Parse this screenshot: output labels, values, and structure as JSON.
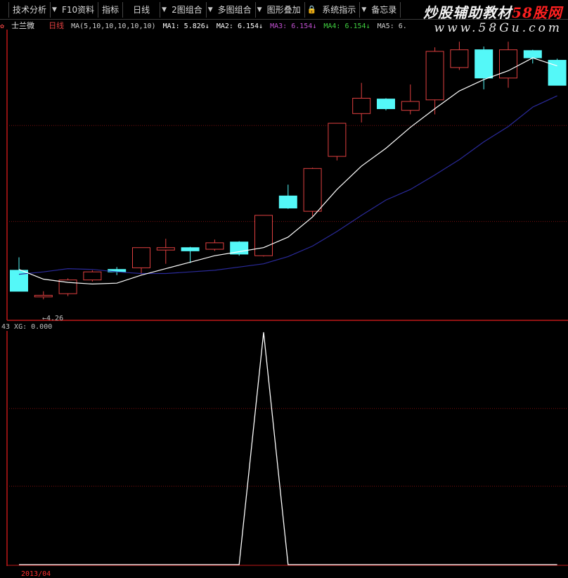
{
  "toolbar": {
    "items": [
      "技术分析",
      "F10资料",
      "指标",
      "日线",
      "2图组合",
      "多图组合",
      "图形叠加",
      "系统指示",
      "备忘录"
    ],
    "arrow": "▼",
    "lock": "🔒"
  },
  "watermark": {
    "line1a": "炒股辅助教材",
    "line1b": "58股网",
    "line2": "www.58Gu.com"
  },
  "stock": {
    "name": "士兰微",
    "period": "日线"
  },
  "ma_header": {
    "spec": "MA(5,10,10,10,10,10)",
    "ma1": "MA1: 5.826↓",
    "ma2": "MA2: 6.154↓",
    "ma3": "MA3: 6.154↓",
    "ma4": "MA4: 6.154↓",
    "ma5": "MA5: 6."
  },
  "low_label": "←4.26",
  "indicator": {
    "label": "43 XG: 0.000"
  },
  "date_label": "2013/04",
  "colors": {
    "up": "#e04040",
    "down": "#54f8f8",
    "ma1": "#ffffff",
    "ma2": "#2a2a9a",
    "grid": "#7a1010",
    "frame": "#c01818",
    "ma3": "#b040c0",
    "ma4": "#40d040"
  },
  "chart_data": {
    "type": "candlestick",
    "price_range": [
      4.0,
      7.6
    ],
    "candles": [
      {
        "o": 4.62,
        "h": 4.78,
        "l": 4.38,
        "c": 4.36
      },
      {
        "o": 4.29,
        "h": 4.36,
        "l": 4.26,
        "c": 4.31
      },
      {
        "o": 4.33,
        "h": 4.52,
        "l": 4.3,
        "c": 4.5
      },
      {
        "o": 4.5,
        "h": 4.62,
        "l": 4.48,
        "c": 4.6
      },
      {
        "o": 4.63,
        "h": 4.66,
        "l": 4.56,
        "c": 4.6
      },
      {
        "o": 4.65,
        "h": 4.88,
        "l": 4.57,
        "c": 4.9
      },
      {
        "o": 4.87,
        "h": 5.01,
        "l": 4.7,
        "c": 4.9
      },
      {
        "o": 4.9,
        "h": 4.91,
        "l": 4.71,
        "c": 4.86
      },
      {
        "o": 4.88,
        "h": 5.0,
        "l": 4.86,
        "c": 4.96
      },
      {
        "o": 4.97,
        "h": 4.98,
        "l": 4.8,
        "c": 4.82
      },
      {
        "o": 4.8,
        "h": 5.3,
        "l": 4.79,
        "c": 5.3
      },
      {
        "o": 5.54,
        "h": 5.68,
        "l": 5.38,
        "c": 5.39
      },
      {
        "o": 5.35,
        "h": 5.89,
        "l": 5.29,
        "c": 5.88
      },
      {
        "o": 6.03,
        "h": 6.05,
        "l": 5.98,
        "c": 6.44
      },
      {
        "o": 6.56,
        "h": 6.94,
        "l": 6.45,
        "c": 6.75
      },
      {
        "o": 6.74,
        "h": 6.75,
        "l": 6.6,
        "c": 6.62
      },
      {
        "o": 6.6,
        "h": 6.92,
        "l": 6.55,
        "c": 6.71
      },
      {
        "o": 6.73,
        "h": 7.38,
        "l": 6.55,
        "c": 7.33
      },
      {
        "o": 7.13,
        "h": 7.45,
        "l": 7.1,
        "c": 7.35
      },
      {
        "o": 7.35,
        "h": 7.39,
        "l": 6.86,
        "c": 7.0
      },
      {
        "o": 7.0,
        "h": 7.45,
        "l": 6.88,
        "c": 7.35
      },
      {
        "o": 7.34,
        "h": 7.35,
        "l": 7.18,
        "c": 7.25
      },
      {
        "o": 7.22,
        "h": 7.24,
        "l": 6.91,
        "c": 6.91
      }
    ],
    "ma1": [
      4.63,
      4.51,
      4.47,
      4.45,
      4.46,
      4.56,
      4.64,
      4.72,
      4.8,
      4.85,
      4.9,
      5.03,
      5.28,
      5.62,
      5.91,
      6.13,
      6.39,
      6.62,
      6.84,
      6.98,
      7.09,
      7.25,
      7.15
    ],
    "ma2": [
      4.57,
      4.6,
      4.64,
      4.63,
      4.6,
      4.58,
      4.58,
      4.6,
      4.62,
      4.66,
      4.7,
      4.79,
      4.92,
      5.1,
      5.3,
      5.49,
      5.62,
      5.8,
      5.99,
      6.21,
      6.4,
      6.64,
      6.78
    ],
    "xg": [
      0,
      0,
      0,
      0,
      0,
      0,
      0,
      0,
      0,
      0,
      1,
      0,
      0,
      0,
      0,
      0,
      0,
      0,
      0,
      0,
      0,
      0,
      0
    ],
    "xg_range": [
      0,
      1
    ]
  }
}
